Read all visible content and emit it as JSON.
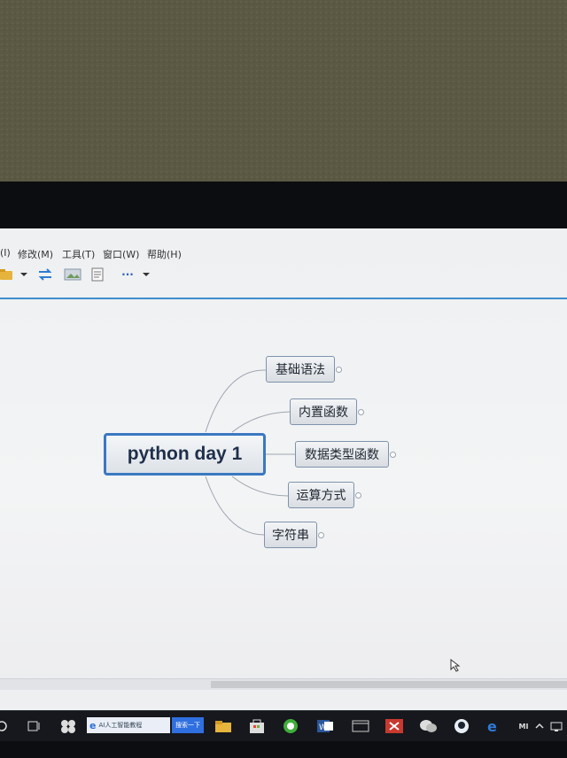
{
  "menu": {
    "items": [
      {
        "label": "(I)"
      },
      {
        "label": "修改(M)"
      },
      {
        "label": "工具(T)"
      },
      {
        "label": "窗口(W)"
      },
      {
        "label": "帮助(H)"
      }
    ]
  },
  "toolbar": {
    "more_label": "···"
  },
  "mindmap": {
    "root": "python day 1",
    "branches": [
      {
        "label": "基础语法"
      },
      {
        "label": "内置函数"
      },
      {
        "label": "数据类型函数"
      },
      {
        "label": "运算方式"
      },
      {
        "label": "字符串"
      }
    ]
  },
  "taskbar": {
    "search_text": "AI人工智能教程",
    "search_button": "搜索一下",
    "app_label": "MI"
  },
  "colors": {
    "accent": "#3a78c2",
    "node_border": "#7f93ab",
    "taskbar": "#16181d"
  }
}
